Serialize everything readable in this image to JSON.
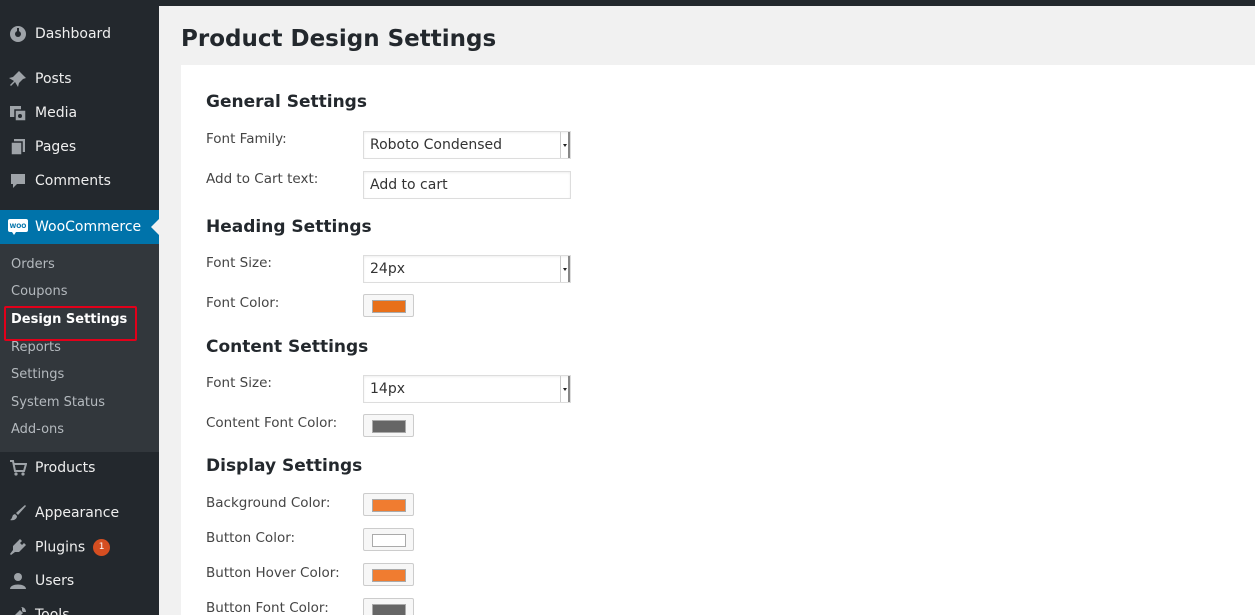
{
  "page": {
    "title": "Product Design Settings"
  },
  "sidebar": {
    "top_items": [
      {
        "label": "Dashboard",
        "icon": "dashboard-icon"
      },
      {
        "label": "Posts",
        "icon": "pin-icon"
      },
      {
        "label": "Media",
        "icon": "media-icon"
      },
      {
        "label": "Pages",
        "icon": "pages-icon"
      },
      {
        "label": "Comments",
        "icon": "comment-icon"
      },
      {
        "label": "WooCommerce",
        "icon": "woo-icon"
      }
    ],
    "woo_submenu": [
      "Orders",
      "Coupons",
      "Design Settings",
      "Reports",
      "Settings",
      "System Status",
      "Add-ons"
    ],
    "bottom_items": [
      {
        "label": "Products",
        "icon": "cart-icon"
      },
      {
        "label": "Appearance",
        "icon": "brush-icon"
      },
      {
        "label": "Plugins",
        "icon": "plugin-icon",
        "badge": "1"
      },
      {
        "label": "Users",
        "icon": "user-icon"
      },
      {
        "label": "Tools",
        "icon": "wrench-icon"
      }
    ],
    "woo_icon_text": "WOO"
  },
  "general": {
    "title": "General Settings",
    "font_family_label": "Font Family:",
    "font_family_value": "Roboto Condensed",
    "add_to_cart_label": "Add to Cart text:",
    "add_to_cart_value": "Add to cart"
  },
  "heading": {
    "title": "Heading Settings",
    "font_size_label": "Font Size:",
    "font_size_value": "24px",
    "font_color_label": "Font Color:",
    "font_color": "#e8701a"
  },
  "content": {
    "title": "Content Settings",
    "font_size_label": "Font Size:",
    "font_size_value": "14px",
    "font_color_label": "Content Font Color:",
    "font_color": "#666666"
  },
  "display": {
    "title": "Display Settings",
    "background_color_label": "Background Color:",
    "background_color": "#f07c30",
    "button_color_label": "Button Color:",
    "button_color": "#ffffff",
    "button_hover_color_label": "Button Hover Color:",
    "button_hover_color": "#f07c30",
    "button_font_color_label": "Button Font Color:",
    "button_font_color": "#666666"
  }
}
